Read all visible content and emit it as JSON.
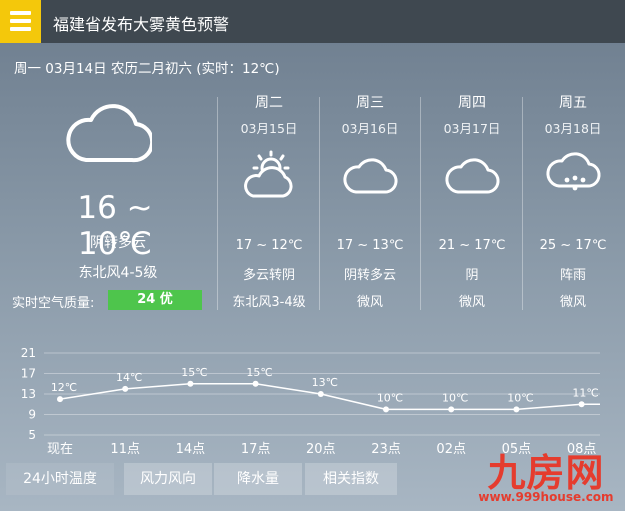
{
  "header": {
    "title": "福建省发布大雾黄色预警"
  },
  "date_line": "周一 03月14日 农历二月初六 (实时：12℃)",
  "today": {
    "icon": "cloud-icon",
    "temp_range": "16 ~ 10℃",
    "weather": "阴转多云",
    "wind": "东北风4-5级",
    "air_quality_label": "实时空气质量:",
    "air_quality_value": "24 优",
    "air_quality_color": "#4ec54c"
  },
  "forecast": [
    {
      "day": "周二",
      "date": "03月15日",
      "icon": "partly-sunny-cloud-icon",
      "temp": "17 ~ 12℃",
      "weather": "多云转阴",
      "wind": "东北风3-4级"
    },
    {
      "day": "周三",
      "date": "03月16日",
      "icon": "cloud-icon",
      "temp": "17 ~ 13℃",
      "weather": "阴转多云",
      "wind": "微风"
    },
    {
      "day": "周四",
      "date": "03月17日",
      "icon": "cloud-icon",
      "temp": "21 ~ 17℃",
      "weather": "阴",
      "wind": "微风"
    },
    {
      "day": "周五",
      "date": "03月18日",
      "icon": "rain-cloud-icon",
      "temp": "25 ~ 17℃",
      "weather": "阵雨",
      "wind": "微风"
    }
  ],
  "chart_data": {
    "type": "line",
    "categories": [
      "现在",
      "11点",
      "14点",
      "17点",
      "20点",
      "23点",
      "02点",
      "05点",
      "08点"
    ],
    "values": [
      12,
      14,
      15,
      15,
      13,
      10,
      10,
      10,
      11
    ],
    "point_labels": [
      "12℃",
      "14℃",
      "15℃",
      "15℃",
      "13℃",
      "10℃",
      "10℃",
      "10℃",
      "11℃"
    ],
    "yticks": [
      5,
      9,
      13,
      17,
      21
    ],
    "ylim": [
      5,
      21
    ],
    "grid": true,
    "title": "",
    "xlabel": "",
    "ylabel": ""
  },
  "tabs": [
    {
      "label": "24小时温度",
      "active": true
    },
    {
      "label": "风力风向",
      "active": false
    },
    {
      "label": "降水量",
      "active": false
    },
    {
      "label": "相关指数",
      "active": false
    }
  ],
  "watermark": {
    "logo_text": "九房网",
    "url": "www.999house.com",
    "color": "#e53c2e"
  }
}
